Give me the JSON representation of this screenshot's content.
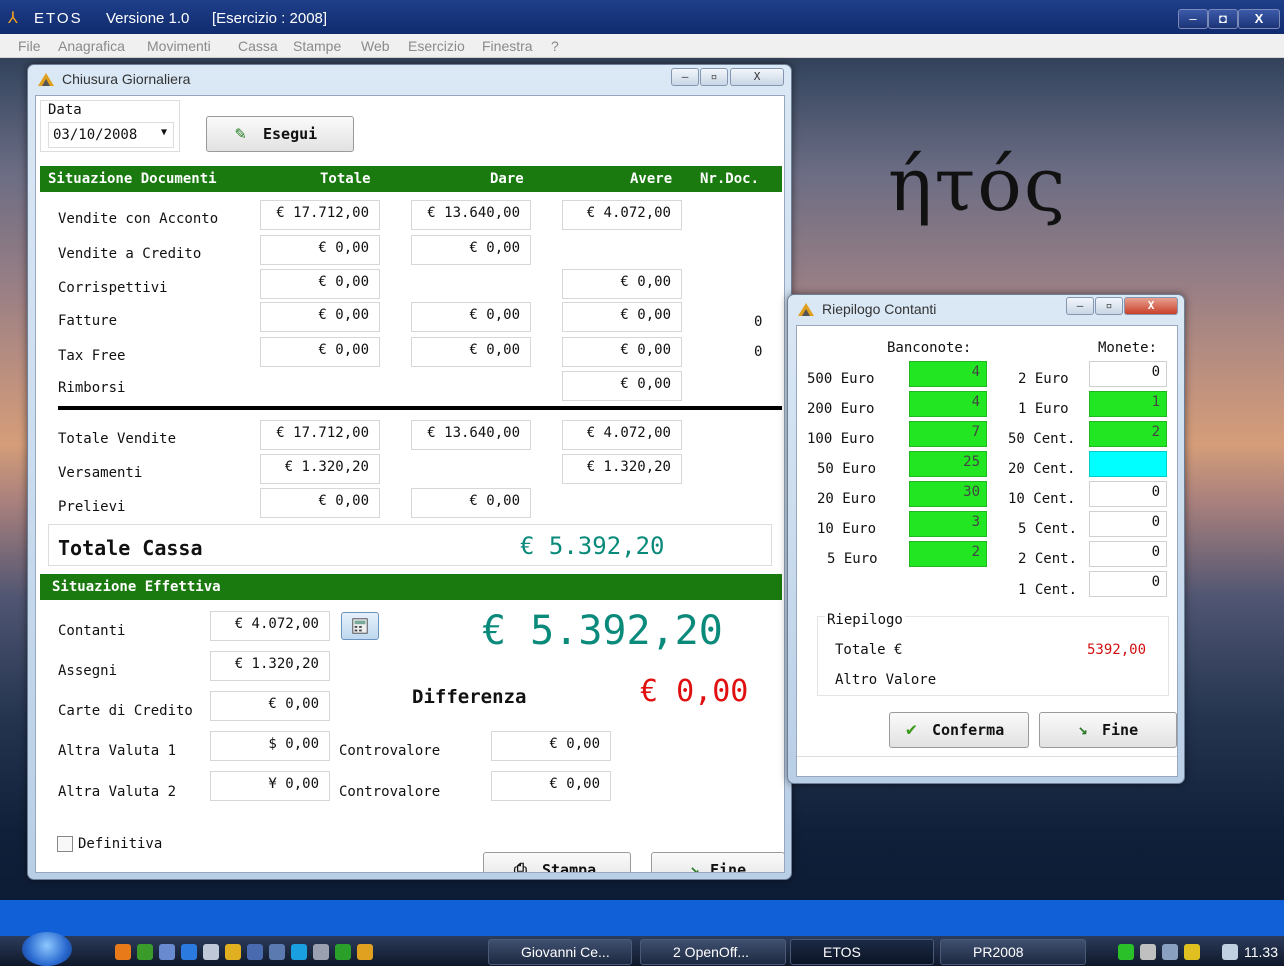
{
  "app": {
    "name": "ETOS",
    "version": "Versione 1.0",
    "year": "[Esercizio : 2008]",
    "minimize": "‒",
    "maximize": "◘",
    "close": "X"
  },
  "menu": [
    "File",
    "Anagrafica",
    "Movimenti",
    "Cassa",
    "Stampe",
    "Web",
    "Esercizio",
    "Finestra",
    "?"
  ],
  "background": {
    "greek_title": "ήτός"
  },
  "chiusura": {
    "title": "Chiusura Giornaliera",
    "data_label": "Data",
    "date_value": "03/10/2008",
    "esegui": "Esegui",
    "header": {
      "section": "Situazione Documenti",
      "totale": "Totale",
      "dare": "Dare",
      "avere": "Avere",
      "nrdoc": "Nr.Doc."
    },
    "rows": [
      {
        "label": "Vendite con Acconto",
        "totale": "€ 17.712,00",
        "dare": "€ 13.640,00",
        "avere": "€ 4.072,00",
        "nr": ""
      },
      {
        "label": "Vendite a Credito",
        "totale": "€ 0,00",
        "dare": "€ 0,00",
        "avere": "",
        "nr": ""
      },
      {
        "label": "Corrispettivi",
        "totale": "€ 0,00",
        "dare": "",
        "avere": "€ 0,00",
        "nr": ""
      },
      {
        "label": "Fatture",
        "totale": "€ 0,00",
        "dare": "€ 0,00",
        "avere": "€ 0,00",
        "nr": "0"
      },
      {
        "label": "Tax Free",
        "totale": "€ 0,00",
        "dare": "€ 0,00",
        "avere": "€ 0,00",
        "nr": "0"
      },
      {
        "label": "Rimborsi",
        "totale": "",
        "dare": "",
        "avere": "€ 0,00",
        "nr": ""
      }
    ],
    "totals": [
      {
        "label": "Totale Vendite",
        "totale": "€ 17.712,00",
        "dare": "€ 13.640,00",
        "avere": "€ 4.072,00"
      },
      {
        "label": "Versamenti",
        "totale": "€ 1.320,20",
        "dare": "",
        "avere": "€ 1.320,20"
      },
      {
        "label": "Prelievi",
        "totale": "€ 0,00",
        "dare": "€ 0,00",
        "avere": ""
      }
    ],
    "totale_cassa_label": "Totale Cassa",
    "totale_cassa_value": "€ 5.392,20",
    "effettiva_header": "Situazione Effettiva",
    "effettiva": [
      {
        "label": "Contanti",
        "value": "€ 4.072,00"
      },
      {
        "label": "Assegni",
        "value": "€ 1.320,20"
      },
      {
        "label": "Carte di Credito",
        "value": "€ 0,00"
      },
      {
        "label": "Altra Valuta 1",
        "value": "$  0,00",
        "controvalore_label": "Controvalore",
        "controvalore": "€ 0,00"
      },
      {
        "label": "Altra Valuta 2",
        "value": "¥  0,00",
        "controvalore_label": "Controvalore",
        "controvalore": "€ 0,00"
      }
    ],
    "big_total": "€ 5.392,20",
    "differenza_label": "Differenza",
    "differenza_value": "€ 0,00",
    "definitiva": "Definitiva",
    "stampa": "Stampa",
    "fine": "Fine"
  },
  "riepilogo": {
    "title": "Riepilogo Contanti",
    "banconote_label": "Banconote:",
    "monete_label": "Monete:",
    "banconote": [
      {
        "label": "500 Euro",
        "count": "4"
      },
      {
        "label": "200 Euro",
        "count": "4"
      },
      {
        "label": "100 Euro",
        "count": "7"
      },
      {
        "label": "50 Euro",
        "count": "25"
      },
      {
        "label": "20 Euro",
        "count": "30"
      },
      {
        "label": "10 Euro",
        "count": "3"
      },
      {
        "label": "5 Euro",
        "count": "2"
      }
    ],
    "monete": [
      {
        "label": "2 Euro",
        "count": "0",
        "state": "white"
      },
      {
        "label": "1 Euro",
        "count": "1",
        "state": "green"
      },
      {
        "label": "50 Cent.",
        "count": "2",
        "state": "green"
      },
      {
        "label": "20 Cent.",
        "count": "",
        "state": "cyan"
      },
      {
        "label": "10 Cent.",
        "count": "0",
        "state": "white"
      },
      {
        "label": "5 Cent.",
        "count": "0",
        "state": "white"
      },
      {
        "label": "2 Cent.",
        "count": "0",
        "state": "white"
      },
      {
        "label": "1 Cent.",
        "count": "0",
        "state": "white"
      }
    ],
    "summary_label": "Riepilogo",
    "totale_label": "Totale €",
    "totale_value": "5392,00",
    "altro_label": "Altro Valore",
    "conferma": "Conferma",
    "fine": "Fine"
  },
  "taskbar": {
    "items": [
      "Giovanni Ce...",
      "2 OpenOff...",
      "ETOS",
      "PR2008"
    ],
    "clock": "11.33"
  },
  "colors": {
    "accent_green": "#1a7a0f",
    "teal_total": "#0a8a7a",
    "red_diff": "#e01010",
    "count_green": "#22e622",
    "cyan": "#00ffff"
  }
}
